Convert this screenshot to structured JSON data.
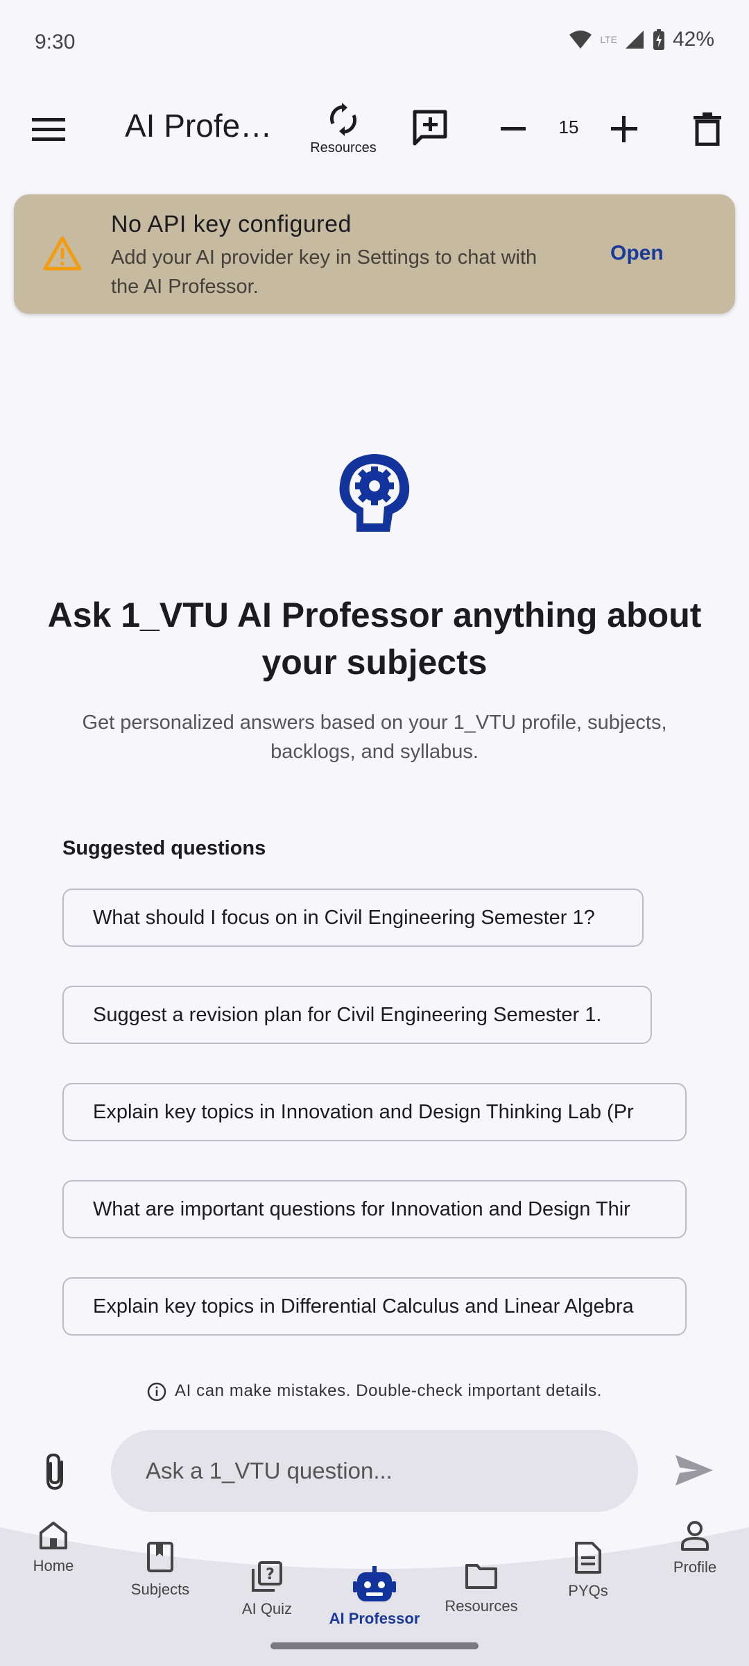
{
  "status_bar": {
    "time": "9:30",
    "battery": "42%"
  },
  "app_bar": {
    "title": "AI Profe…",
    "resources_label": "Resources",
    "zoom_value": "15"
  },
  "banner": {
    "title": "No API key configured",
    "message": "Add your AI provider key in Settings to chat with the AI Professor.",
    "action": "Open"
  },
  "hero": {
    "title": "Ask 1_VTU AI Professor anything about your subjects",
    "subtitle": "Get personalized answers based on your 1_VTU profile, subjects, backlogs, and syllabus."
  },
  "suggestions": {
    "heading": "Suggested questions",
    "items": [
      "What should I focus on in Civil Engineering Semester 1?",
      "Suggest a revision plan for Civil Engineering Semester 1.",
      "Explain key topics in Innovation and Design Thinking Lab (Pr",
      "What are important questions for Innovation and Design Thir",
      "Explain key topics in Differential Calculus and Linear Algebra"
    ]
  },
  "disclaimer": "AI can make mistakes. Double-check important details.",
  "composer": {
    "placeholder": "Ask a 1_VTU question..."
  },
  "nav": [
    {
      "label": "Home",
      "icon": "home-icon"
    },
    {
      "label": "Subjects",
      "icon": "book-icon"
    },
    {
      "label": "AI Quiz",
      "icon": "quiz-icon"
    },
    {
      "label": "AI Professor",
      "icon": "robot-icon"
    },
    {
      "label": "Resources",
      "icon": "folder-icon"
    },
    {
      "label": "PYQs",
      "icon": "document-icon"
    },
    {
      "label": "Profile",
      "icon": "person-icon"
    }
  ],
  "colors": {
    "accent": "#1a3a9a",
    "banner_bg": "#c6baa0",
    "warning": "#f39c12"
  }
}
